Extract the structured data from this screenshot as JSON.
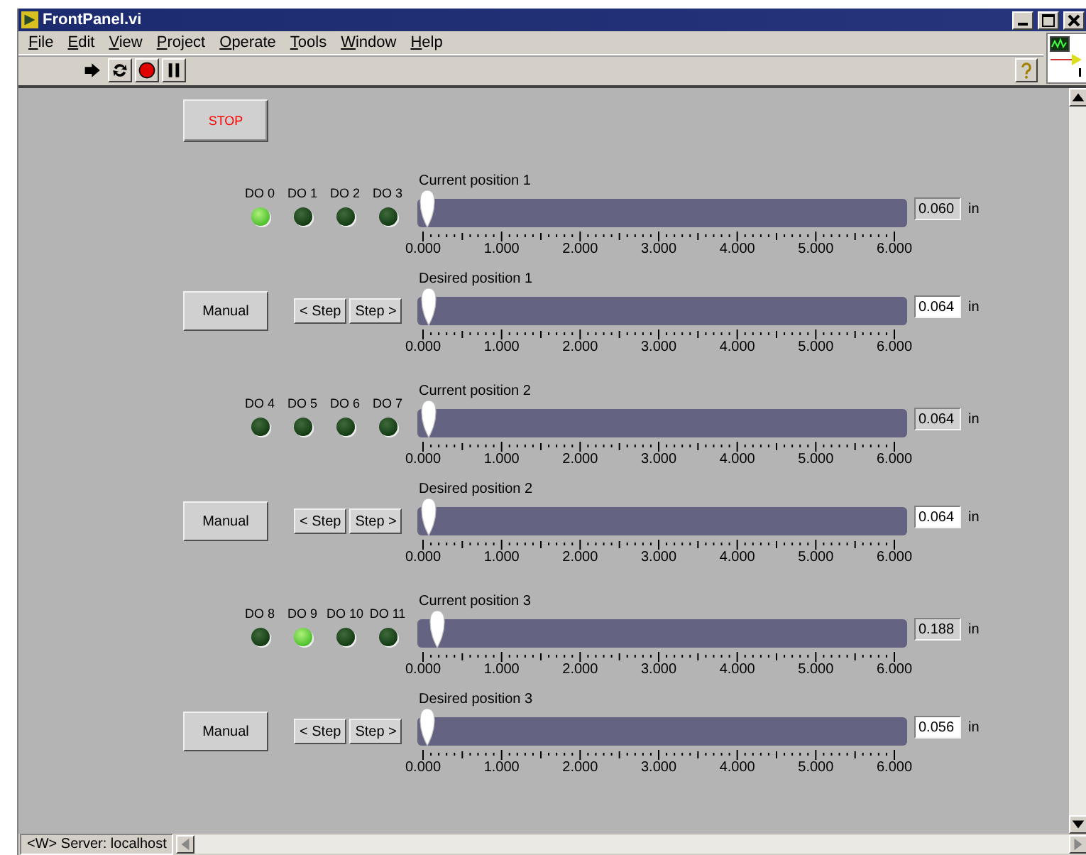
{
  "window": {
    "title": "FrontPanel.vi"
  },
  "menu": [
    "File",
    "Edit",
    "View",
    "Project",
    "Operate",
    "Tools",
    "Window",
    "Help"
  ],
  "toolbar": [
    {
      "kind": "run"
    },
    {
      "kind": "run-continuous"
    },
    {
      "kind": "abort"
    },
    {
      "kind": "pause"
    }
  ],
  "stop_button": {
    "label": "STOP"
  },
  "sections": [
    {
      "leds": [
        {
          "label": "DO 0",
          "on": true
        },
        {
          "label": "DO 1",
          "on": false
        },
        {
          "label": "DO 2",
          "on": false
        },
        {
          "label": "DO 3",
          "on": false
        }
      ],
      "current": {
        "label": "Current position 1",
        "level": 0.01,
        "ticks": [
          "0.000",
          "1.000",
          "2.000",
          "3.000",
          "4.000",
          "5.000",
          "6.000"
        ],
        "reading": "0.060",
        "unit": "in"
      },
      "buttons": [
        "Manual",
        "< Step",
        "Step >"
      ],
      "desired": {
        "label": "Desired position 1",
        "level": 0.0107,
        "ticks": [
          "0.000",
          "1.000",
          "2.000",
          "3.000",
          "4.000",
          "5.000",
          "6.000"
        ],
        "reading": "0.064",
        "unit": "in"
      }
    },
    {
      "leds": [
        {
          "label": "DO 4",
          "on": false
        },
        {
          "label": "DO 5",
          "on": false
        },
        {
          "label": "DO 6",
          "on": false
        },
        {
          "label": "DO 7",
          "on": false
        }
      ],
      "current": {
        "label": "Current position 2",
        "level": 0.0107,
        "ticks": [
          "0.000",
          "1.000",
          "2.000",
          "3.000",
          "4.000",
          "5.000",
          "6.000"
        ],
        "reading": "0.064",
        "unit": "in"
      },
      "buttons": [
        "Manual",
        "< Step",
        "Step >"
      ],
      "desired": {
        "label": "Desired position 2",
        "level": 0.0107,
        "ticks": [
          "0.000",
          "1.000",
          "2.000",
          "3.000",
          "4.000",
          "5.000",
          "6.000"
        ],
        "reading": "0.064",
        "unit": "in"
      }
    },
    {
      "leds": [
        {
          "label": "DO 8",
          "on": false
        },
        {
          "label": "DO 9",
          "on": true
        },
        {
          "label": "DO 10",
          "on": false
        },
        {
          "label": "DO 11",
          "on": false
        }
      ],
      "current": {
        "label": "Current position 3",
        "level": 0.0313,
        "ticks": [
          "0.000",
          "1.000",
          "2.000",
          "3.000",
          "4.000",
          "5.000",
          "6.000"
        ],
        "reading": "0.188",
        "unit": "in"
      },
      "buttons": [
        "Manual",
        "< Step",
        "Step >"
      ],
      "desired": {
        "label": "Desired position 3",
        "level": 0.0093,
        "ticks": [
          "0.000",
          "1.000",
          "2.000",
          "3.000",
          "4.000",
          "5.000",
          "6.000"
        ],
        "reading": "0.056",
        "unit": "in"
      }
    }
  ],
  "status_bar": {
    "text": "<W> Server: localhost"
  }
}
